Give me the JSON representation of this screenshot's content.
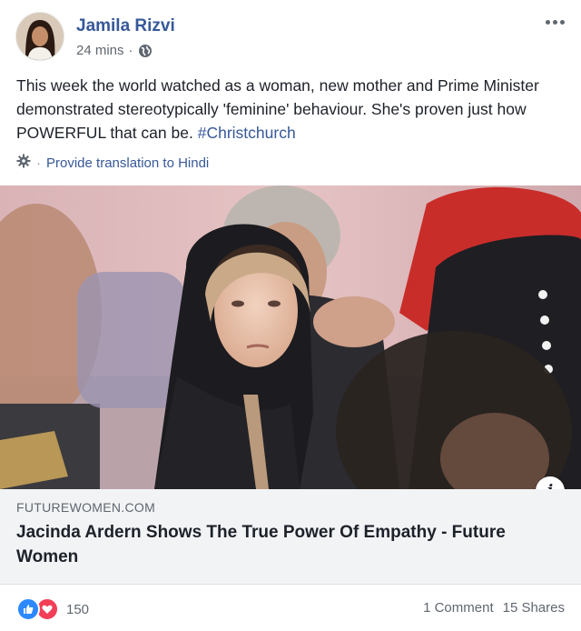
{
  "post": {
    "author": "Jamila Rizvi",
    "time": "24 mins",
    "time_separator": "·",
    "privacy_icon": "globe-icon",
    "text": "This week the world watched as a woman, new mother and Prime Minister demonstrated stereotypically 'feminine' behaviour. She's proven just how POWERFUL that can be. ",
    "hashtag": "#Christchurch",
    "translation": {
      "icon": "gear-icon",
      "separator": "·",
      "label": "Provide translation to Hindi"
    }
  },
  "link": {
    "domain": "FUTUREWOMEN.COM",
    "title": "Jacinda Ardern Shows The True Power Of Empathy - Future Women",
    "info_label": "i"
  },
  "footer": {
    "reaction_count": "150",
    "comments": "1 Comment",
    "shares": "15 Shares"
  },
  "colors": {
    "link_blue": "#365899",
    "like_blue": "#2d88ff",
    "love_red": "#f33e58",
    "muted": "#606770"
  }
}
